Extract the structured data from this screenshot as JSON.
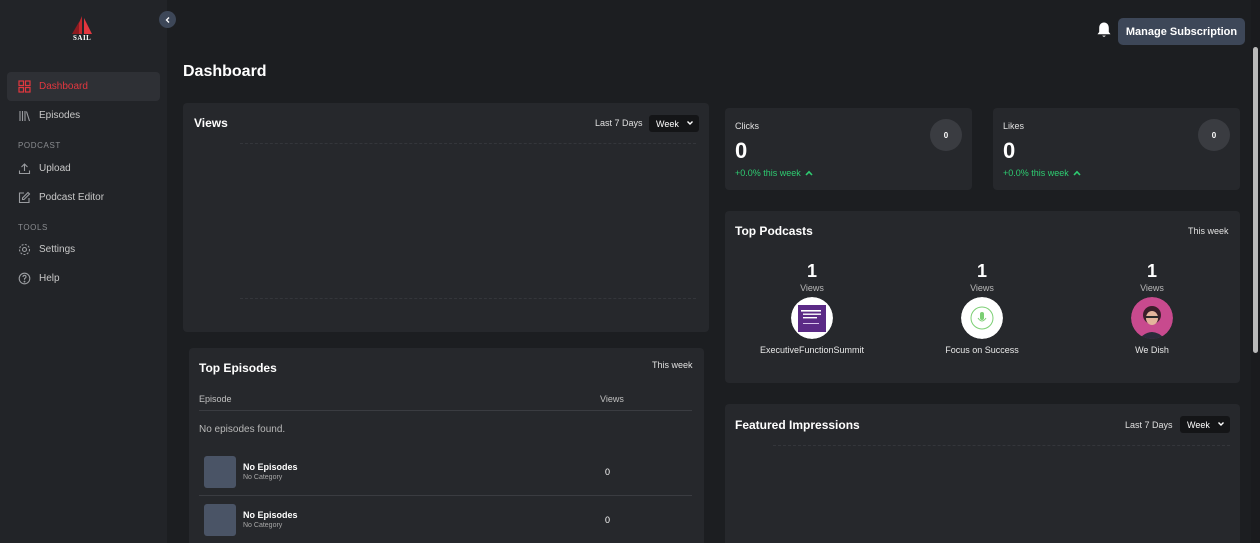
{
  "app": {
    "logo_text": "SAIL"
  },
  "sidebar": {
    "items": [
      {
        "label": "Dashboard",
        "icon": "grid-icon",
        "active": true
      },
      {
        "label": "Episodes",
        "icon": "library-icon"
      }
    ],
    "podcast_section": "PODCAST",
    "podcast_items": [
      {
        "label": "Upload",
        "icon": "upload-icon"
      },
      {
        "label": "Podcast Editor",
        "icon": "edit-icon"
      }
    ],
    "tools_section": "TOOLS",
    "tools_items": [
      {
        "label": "Settings",
        "icon": "gear-icon"
      },
      {
        "label": "Help",
        "icon": "help-icon"
      }
    ]
  },
  "header": {
    "manage_subscription": "Manage Subscription",
    "notification_icon": "bell-icon"
  },
  "page": {
    "title": "Dashboard"
  },
  "views_card": {
    "title": "Views",
    "range_label": "Last 7 Days",
    "select_value": "Week"
  },
  "clicks_card": {
    "label": "Clicks",
    "value": "0",
    "badge": "0",
    "change": "+0.0% this week"
  },
  "likes_card": {
    "label": "Likes",
    "value": "0",
    "badge": "0",
    "change": "+0.0% this week"
  },
  "top_podcasts": {
    "title": "Top Podcasts",
    "period": "This week",
    "items": [
      {
        "count": "1",
        "views_label": "Views",
        "name": "ExecutiveFunctionSummit"
      },
      {
        "count": "1",
        "views_label": "Views",
        "name": "Focus on Success"
      },
      {
        "count": "1",
        "views_label": "Views",
        "name": "We Dish"
      }
    ]
  },
  "top_episodes": {
    "title": "Top Episodes",
    "period": "This week",
    "columns": [
      "Episode",
      "Views"
    ],
    "empty_message": "No episodes found.",
    "rows": [
      {
        "title": "No Episodes",
        "category": "No Category",
        "views": "0"
      },
      {
        "title": "No Episodes",
        "category": "No Category",
        "views": "0"
      }
    ]
  },
  "featured_impressions": {
    "title": "Featured Impressions",
    "range_label": "Last 7 Days",
    "select_value": "Week"
  },
  "colors": {
    "accent_red": "#e2373f",
    "positive_green": "#2ecc71",
    "button_bg": "#3d4758"
  }
}
